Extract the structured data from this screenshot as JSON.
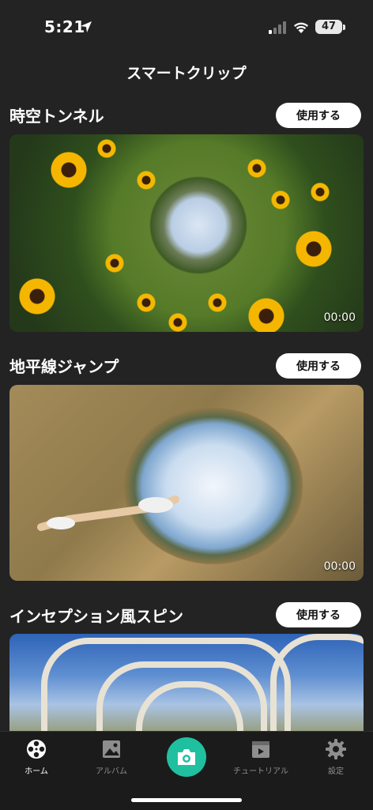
{
  "status_bar": {
    "time": "5:21",
    "battery": "47"
  },
  "page_title": "スマートクリップ",
  "sections": [
    {
      "title": "時空トンネル",
      "button": "使用する",
      "duration": "00:00"
    },
    {
      "title": "地平線ジャンプ",
      "button": "使用する",
      "duration": "00:00"
    },
    {
      "title": "インセプション風スピン",
      "button": "使用する"
    }
  ],
  "tabs": [
    {
      "label": "ホーム",
      "icon": "film-reel-icon",
      "active": true
    },
    {
      "label": "アルバム",
      "icon": "image-icon",
      "active": false
    },
    {
      "label": "",
      "icon": "camera-icon",
      "active": false
    },
    {
      "label": "チュートリアル",
      "icon": "video-tutorial-icon",
      "active": false
    },
    {
      "label": "設定",
      "icon": "gear-icon",
      "active": false
    }
  ],
  "colors": {
    "background": "#232323",
    "accent": "#1fc0a0",
    "tab_bar": "#1b1b1b"
  }
}
